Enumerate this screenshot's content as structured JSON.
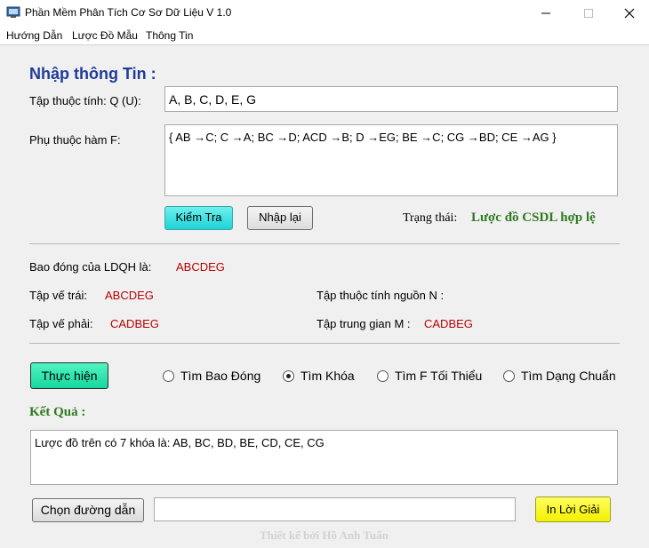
{
  "window": {
    "title": "Phần Mềm Phân Tích Cơ Sơ Dữ Liệu V 1.0",
    "icons": [
      "app-icon",
      "minimize-icon",
      "maximize-icon",
      "close-icon"
    ]
  },
  "menu": [
    "Hướng Dẫn",
    "Lược Đồ Mẫu",
    "Thông Tin"
  ],
  "input": {
    "heading": "Nhập thông Tin :",
    "attributes_label": "Tập thuộc tính: Q (U):",
    "attributes_value": "A, B, C, D, E, G",
    "fd_label": "Phụ thuộc hàm F:",
    "fd_value": "{ AB →C; C →A; BC →D; ACD →B; D →EG; BE →C; CG →BD; CE →AG }",
    "check_button": "Kiểm Tra",
    "reset_button": "Nhập lại",
    "status_label": "Trạng thái:",
    "status_value": "Lược đồ CSDL hợp lệ"
  },
  "analysis": {
    "closure_label": "Bao đóng của LDQH là:",
    "closure_value": "ABCDEG",
    "left_label": "Tập vế trái:",
    "left_value": "ABCDEG",
    "right_label": "Tập vế phải:",
    "right_value": "CADBEG",
    "source_label": "Tập thuộc tính nguồn N :",
    "source_value": "",
    "middle_label": "Tập trung gian M :",
    "middle_value": "CADBEG"
  },
  "actions": {
    "run_button": "Thực hiện",
    "options": [
      {
        "label": "Tìm Bao Đóng",
        "checked": false
      },
      {
        "label": "Tìm Khóa",
        "checked": true
      },
      {
        "label": "Tìm F Tối Thiểu",
        "checked": false
      },
      {
        "label": "Tìm Dạng Chuẩn",
        "checked": false
      }
    ]
  },
  "result": {
    "heading": "Kết Quả :",
    "text": "Lược đồ trên có 7 khóa là: AB, BC, BD, BE, CD, CE, CG"
  },
  "export": {
    "path_button": "Chọn đường dẫn",
    "path_value": "",
    "print_button": "In Lời Giải"
  },
  "footer": "Thiết kế bởi Hồ Anh Tuấn",
  "colors": {
    "heading": "#1f3c9a",
    "status": "#2d7a1f",
    "value_red": "#b80000",
    "check_button": "#1ed3d6",
    "run_button": "#17d6a0",
    "print_button": "#f4f000"
  }
}
